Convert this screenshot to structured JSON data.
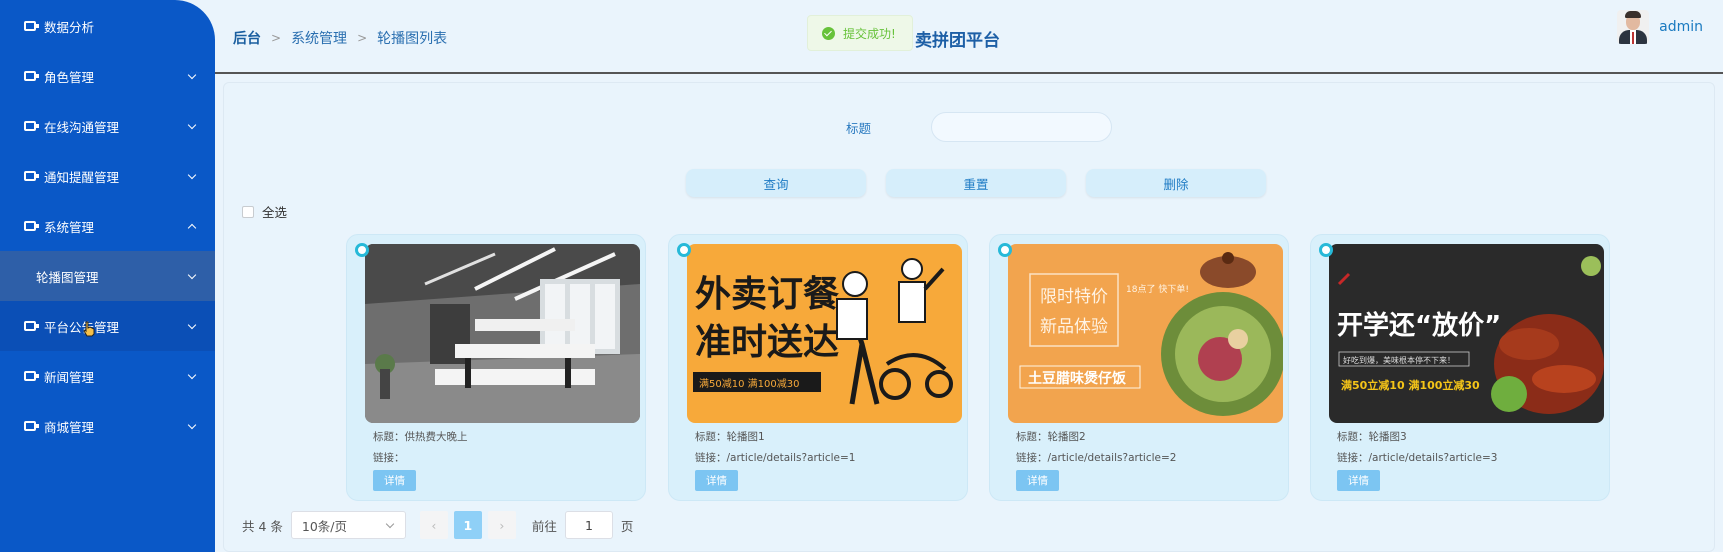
{
  "sidebar": {
    "items": [
      {
        "label": "数据分析",
        "chevron": "none"
      },
      {
        "label": "角色管理",
        "chevron": "down"
      },
      {
        "label": "在线沟通管理",
        "chevron": "down"
      },
      {
        "label": "通知提醒管理",
        "chevron": "down"
      },
      {
        "label": "系统管理",
        "chevron": "up"
      },
      {
        "label": "轮播图管理",
        "chevron": "down",
        "submenu": true
      },
      {
        "label": "平台公告管理",
        "chevron": "down"
      },
      {
        "label": "新闻管理",
        "chevron": "down"
      },
      {
        "label": "商城管理",
        "chevron": "down"
      }
    ]
  },
  "header": {
    "breadcrumb": [
      "后台",
      "系统管理",
      "轮播图列表"
    ],
    "platform_title": "卖拼团平台",
    "toast": "提交成功!",
    "username": "admin"
  },
  "search": {
    "label": "标题",
    "value": ""
  },
  "actions": {
    "query": "查询",
    "reset": "重置",
    "delete": "删除"
  },
  "select_all": "全选",
  "cards": [
    {
      "title": "标题：供热费大晚上",
      "link": "链接：",
      "detail": "详情",
      "image": {
        "kind": "office-photo"
      }
    },
    {
      "title": "标题：轮播图1",
      "link": "链接：/article/details?article=1",
      "detail": "详情",
      "image": {
        "kind": "delivery-poster",
        "line1": "外卖订餐",
        "line2": "准时送达",
        "promo": "满50减10  满100减30"
      }
    },
    {
      "title": "标题：轮播图2",
      "link": "链接：/article/details?article=2",
      "detail": "详情",
      "image": {
        "kind": "claypot-poster",
        "line1": "限时特价",
        "line2": "新品体验",
        "side": "18点了 快下单!",
        "name": "土豆腊味煲仔饭"
      }
    },
    {
      "title": "标题：轮播图3",
      "link": "链接：/article/details?article=3",
      "detail": "详情",
      "image": {
        "kind": "sausage-poster",
        "headline": "开学还“放价”",
        "sub": "好吃到爆，美味根本停不下来！",
        "promo": "满50立减10  满100立减30"
      }
    }
  ],
  "pagination": {
    "total": "共 4 条",
    "page_size": "10条/页",
    "prev": "‹",
    "current": "1",
    "next": "›",
    "goto_label": "前往",
    "goto_value": "1",
    "page_suffix": "页"
  },
  "colors": {
    "sidebar": "#0a58c7",
    "accent": "#1a7ac0",
    "card_bg": "#d9f0fb",
    "detail_button": "#7cc5f2",
    "toast_green": "#67c23a"
  }
}
